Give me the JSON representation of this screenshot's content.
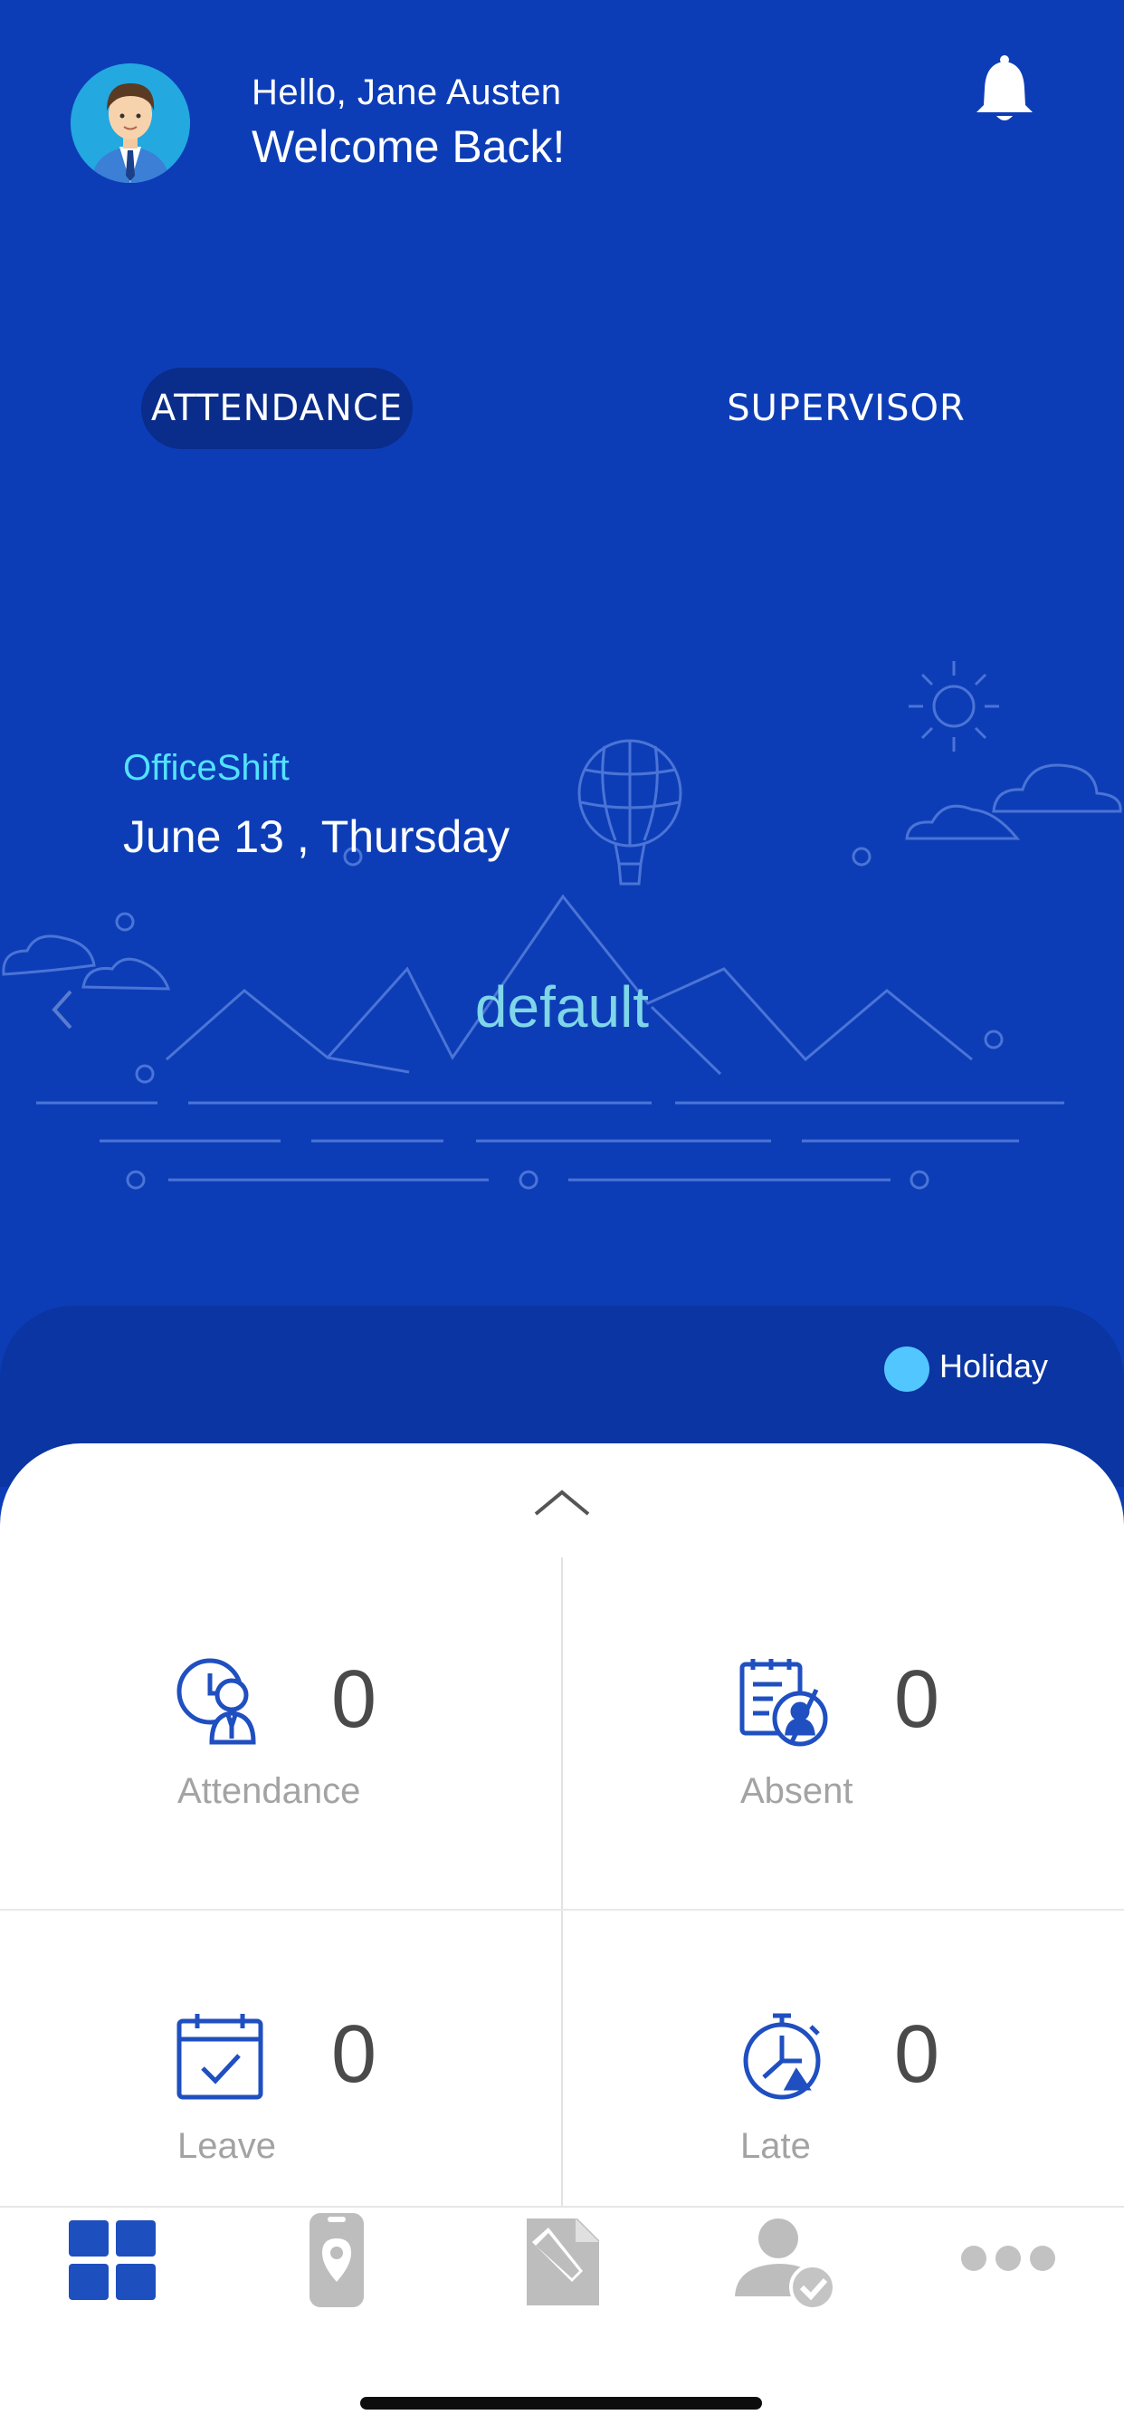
{
  "header": {
    "greeting": "Hello,  Jane Austen",
    "welcome": "Welcome Back!"
  },
  "segments": {
    "active": "ATTENDANCE",
    "other": "SUPERVISOR"
  },
  "shift": {
    "name": "OfficeShift",
    "date": "June 13 , Thursday",
    "status": "default"
  },
  "legend": {
    "label": "Holiday",
    "color": "#52c6ff"
  },
  "stats": [
    {
      "label": "Attendance",
      "value": "0",
      "icon": "attendance-clock-person-icon"
    },
    {
      "label": "Absent",
      "value": "0",
      "icon": "absent-calendar-person-icon"
    },
    {
      "label": "Leave",
      "value": "0",
      "icon": "leave-calendar-check-icon"
    },
    {
      "label": "Late",
      "value": "0",
      "icon": "late-stopwatch-icon"
    }
  ],
  "tabs": [
    {
      "name": "dashboard",
      "icon": "grid-icon",
      "active": true
    },
    {
      "name": "location",
      "icon": "phone-location-icon",
      "active": false
    },
    {
      "name": "request",
      "icon": "document-edit-icon",
      "active": false
    },
    {
      "name": "approval",
      "icon": "user-check-icon",
      "active": false
    },
    {
      "name": "more",
      "icon": "more-dots-icon",
      "active": false
    }
  ],
  "colors": {
    "background": "#0d3db6",
    "accent": "#1f4fc0",
    "active_tab": "#1e4fbf",
    "inactive_tab": "#bdbdbd"
  }
}
